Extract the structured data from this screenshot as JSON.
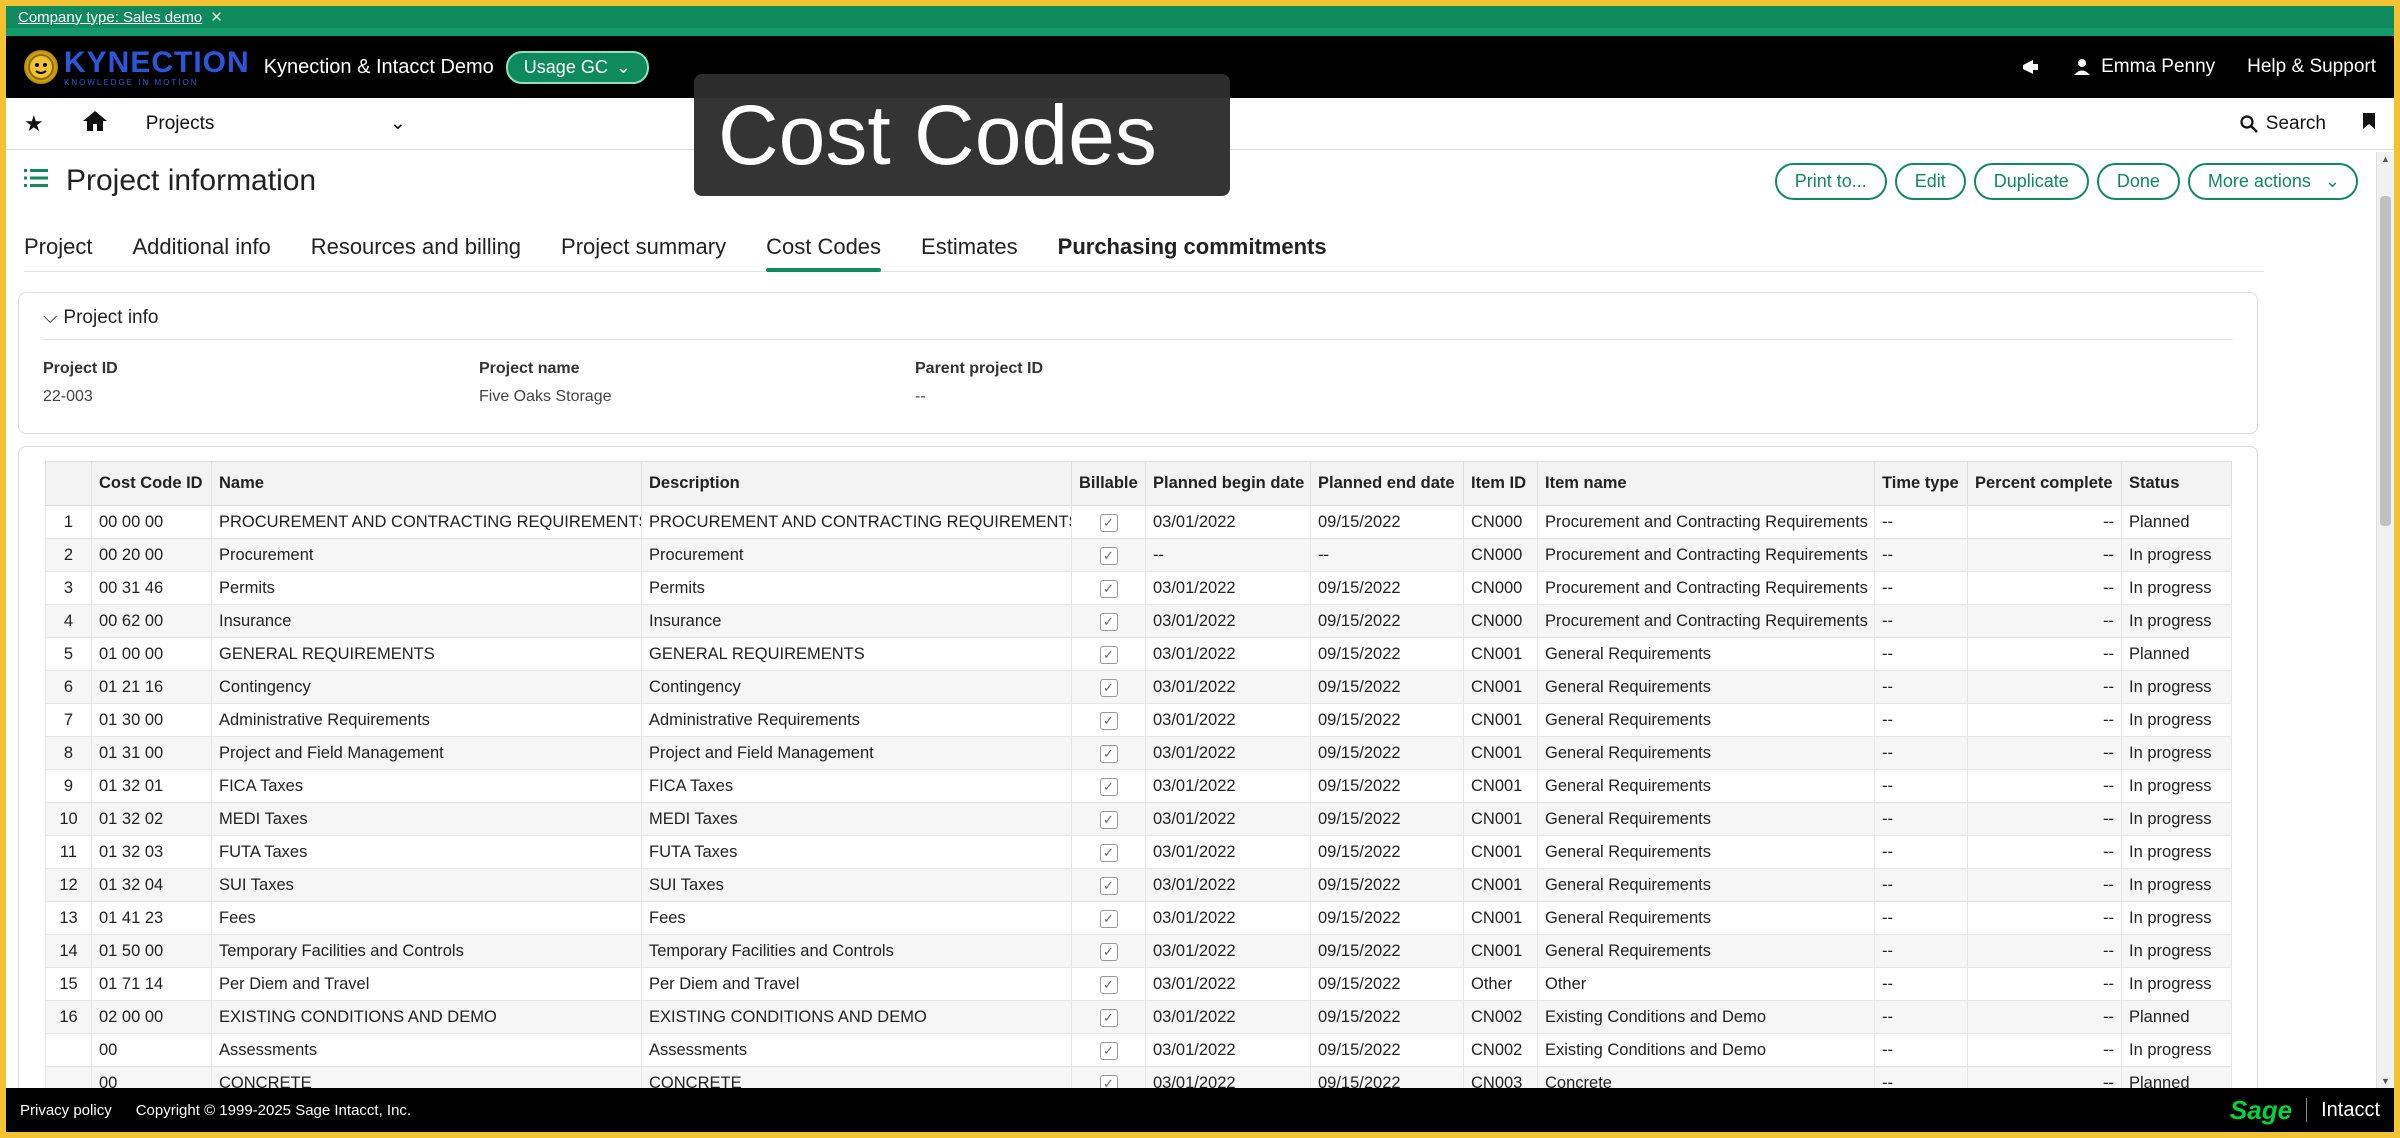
{
  "company_strip": {
    "label": "Company type: Sales demo",
    "close": "✕"
  },
  "header": {
    "logo_word": "KYNECTION",
    "logo_tag": "KNOWLEDGE IN MOTION",
    "company_name": "Kynection & Intacct Demo",
    "entity": "Usage GC",
    "user": "Emma Penny",
    "help": "Help & Support"
  },
  "nav": {
    "module": "Projects",
    "search": "Search"
  },
  "overlay": {
    "title": "Cost Codes"
  },
  "page": {
    "title": "Project information",
    "actions": {
      "print": "Print to...",
      "edit": "Edit",
      "duplicate": "Duplicate",
      "done": "Done",
      "more": "More actions"
    }
  },
  "tabs": [
    {
      "label": "Project"
    },
    {
      "label": "Additional info"
    },
    {
      "label": "Resources and billing"
    },
    {
      "label": "Project summary"
    },
    {
      "label": "Cost Codes"
    },
    {
      "label": "Estimates"
    },
    {
      "label": "Purchasing commitments"
    }
  ],
  "project_info": {
    "section": "Project info",
    "project_id_label": "Project ID",
    "project_id": "22-003",
    "project_name_label": "Project name",
    "project_name": "Five Oaks Storage",
    "parent_label": "Parent project ID",
    "parent": "--"
  },
  "table": {
    "columns": [
      "Cost Code ID",
      "Name",
      "Description",
      "Billable",
      "Planned begin date",
      "Planned end date",
      "Item ID",
      "Item name",
      "Time type",
      "Percent complete",
      "Status"
    ],
    "rows": [
      {
        "n": "1",
        "code": "00 00 00",
        "name": "PROCUREMENT AND CONTRACTING REQUIREMENTS",
        "desc": "PROCUREMENT AND CONTRACTING REQUIREMENTS",
        "begin": "03/01/2022",
        "end": "09/15/2022",
        "item": "CN000",
        "item_name": "Procurement and Contracting Requirements",
        "time": "--",
        "pct": "--",
        "status": "Planned"
      },
      {
        "n": "2",
        "code": "00 20 00",
        "name": "Procurement",
        "desc": "Procurement",
        "begin": "--",
        "end": "--",
        "item": "CN000",
        "item_name": "Procurement and Contracting Requirements",
        "time": "--",
        "pct": "--",
        "status": "In progress"
      },
      {
        "n": "3",
        "code": "00 31 46",
        "name": "Permits",
        "desc": "Permits",
        "begin": "03/01/2022",
        "end": "09/15/2022",
        "item": "CN000",
        "item_name": "Procurement and Contracting Requirements",
        "time": "--",
        "pct": "--",
        "status": "In progress"
      },
      {
        "n": "4",
        "code": "00 62 00",
        "name": "Insurance",
        "desc": "Insurance",
        "begin": "03/01/2022",
        "end": "09/15/2022",
        "item": "CN000",
        "item_name": "Procurement and Contracting Requirements",
        "time": "--",
        "pct": "--",
        "status": "In progress"
      },
      {
        "n": "5",
        "code": "01 00 00",
        "name": "GENERAL REQUIREMENTS",
        "desc": "GENERAL REQUIREMENTS",
        "begin": "03/01/2022",
        "end": "09/15/2022",
        "item": "CN001",
        "item_name": "General Requirements",
        "time": "--",
        "pct": "--",
        "status": "Planned"
      },
      {
        "n": "6",
        "code": "01 21 16",
        "name": "Contingency",
        "desc": "Contingency",
        "begin": "03/01/2022",
        "end": "09/15/2022",
        "item": "CN001",
        "item_name": "General Requirements",
        "time": "--",
        "pct": "--",
        "status": "In progress"
      },
      {
        "n": "7",
        "code": "01 30 00",
        "name": "Administrative Requirements",
        "desc": "Administrative Requirements",
        "begin": "03/01/2022",
        "end": "09/15/2022",
        "item": "CN001",
        "item_name": "General Requirements",
        "time": "--",
        "pct": "--",
        "status": "In progress"
      },
      {
        "n": "8",
        "code": "01 31 00",
        "name": "Project and Field Management",
        "desc": "Project and Field Management",
        "begin": "03/01/2022",
        "end": "09/15/2022",
        "item": "CN001",
        "item_name": "General Requirements",
        "time": "--",
        "pct": "--",
        "status": "In progress"
      },
      {
        "n": "9",
        "code": "01 32 01",
        "name": "FICA Taxes",
        "desc": "FICA Taxes",
        "begin": "03/01/2022",
        "end": "09/15/2022",
        "item": "CN001",
        "item_name": "General Requirements",
        "time": "--",
        "pct": "--",
        "status": "In progress"
      },
      {
        "n": "10",
        "code": "01 32 02",
        "name": "MEDI Taxes",
        "desc": "MEDI Taxes",
        "begin": "03/01/2022",
        "end": "09/15/2022",
        "item": "CN001",
        "item_name": "General Requirements",
        "time": "--",
        "pct": "--",
        "status": "In progress"
      },
      {
        "n": "11",
        "code": "01 32 03",
        "name": "FUTA Taxes",
        "desc": "FUTA Taxes",
        "begin": "03/01/2022",
        "end": "09/15/2022",
        "item": "CN001",
        "item_name": "General Requirements",
        "time": "--",
        "pct": "--",
        "status": "In progress"
      },
      {
        "n": "12",
        "code": "01 32 04",
        "name": "SUI Taxes",
        "desc": "SUI Taxes",
        "begin": "03/01/2022",
        "end": "09/15/2022",
        "item": "CN001",
        "item_name": "General Requirements",
        "time": "--",
        "pct": "--",
        "status": "In progress"
      },
      {
        "n": "13",
        "code": "01 41 23",
        "name": "Fees",
        "desc": "Fees",
        "begin": "03/01/2022",
        "end": "09/15/2022",
        "item": "CN001",
        "item_name": "General Requirements",
        "time": "--",
        "pct": "--",
        "status": "In progress"
      },
      {
        "n": "14",
        "code": "01 50 00",
        "name": "Temporary Facilities and Controls",
        "desc": "Temporary Facilities and Controls",
        "begin": "03/01/2022",
        "end": "09/15/2022",
        "item": "CN001",
        "item_name": "General Requirements",
        "time": "--",
        "pct": "--",
        "status": "In progress"
      },
      {
        "n": "15",
        "code": "01 71 14",
        "name": "Per Diem and Travel",
        "desc": "Per Diem and Travel",
        "begin": "03/01/2022",
        "end": "09/15/2022",
        "item": "Other",
        "item_name": "Other",
        "time": "--",
        "pct": "--",
        "status": "In progress"
      },
      {
        "n": "16",
        "code": "02 00 00",
        "name": "EXISTING CONDITIONS AND DEMO",
        "desc": "EXISTING CONDITIONS AND DEMO",
        "begin": "03/01/2022",
        "end": "09/15/2022",
        "item": "CN002",
        "item_name": "Existing Conditions and Demo",
        "time": "--",
        "pct": "--",
        "status": "Planned"
      },
      {
        "n": "",
        "code": "00",
        "name": "Assessments",
        "desc": "Assessments",
        "begin": "03/01/2022",
        "end": "09/15/2022",
        "item": "CN002",
        "item_name": "Existing Conditions and Demo",
        "time": "--",
        "pct": "--",
        "status": "In progress"
      },
      {
        "n": "",
        "code": "00",
        "name": "CONCRETE",
        "desc": "CONCRETE",
        "begin": "03/01/2022",
        "end": "09/15/2022",
        "item": "CN003",
        "item_name": "Concrete",
        "time": "--",
        "pct": "--",
        "status": "Planned"
      }
    ]
  },
  "footer": {
    "privacy": "Privacy policy",
    "copyright": "Copyright © 1999-2025 Sage Intacct, Inc.",
    "sage": "Sage",
    "intacct": "Intacct"
  },
  "colors": {
    "accent": "#0f8a5f",
    "frame": "#f1c232",
    "header": "#000000"
  }
}
